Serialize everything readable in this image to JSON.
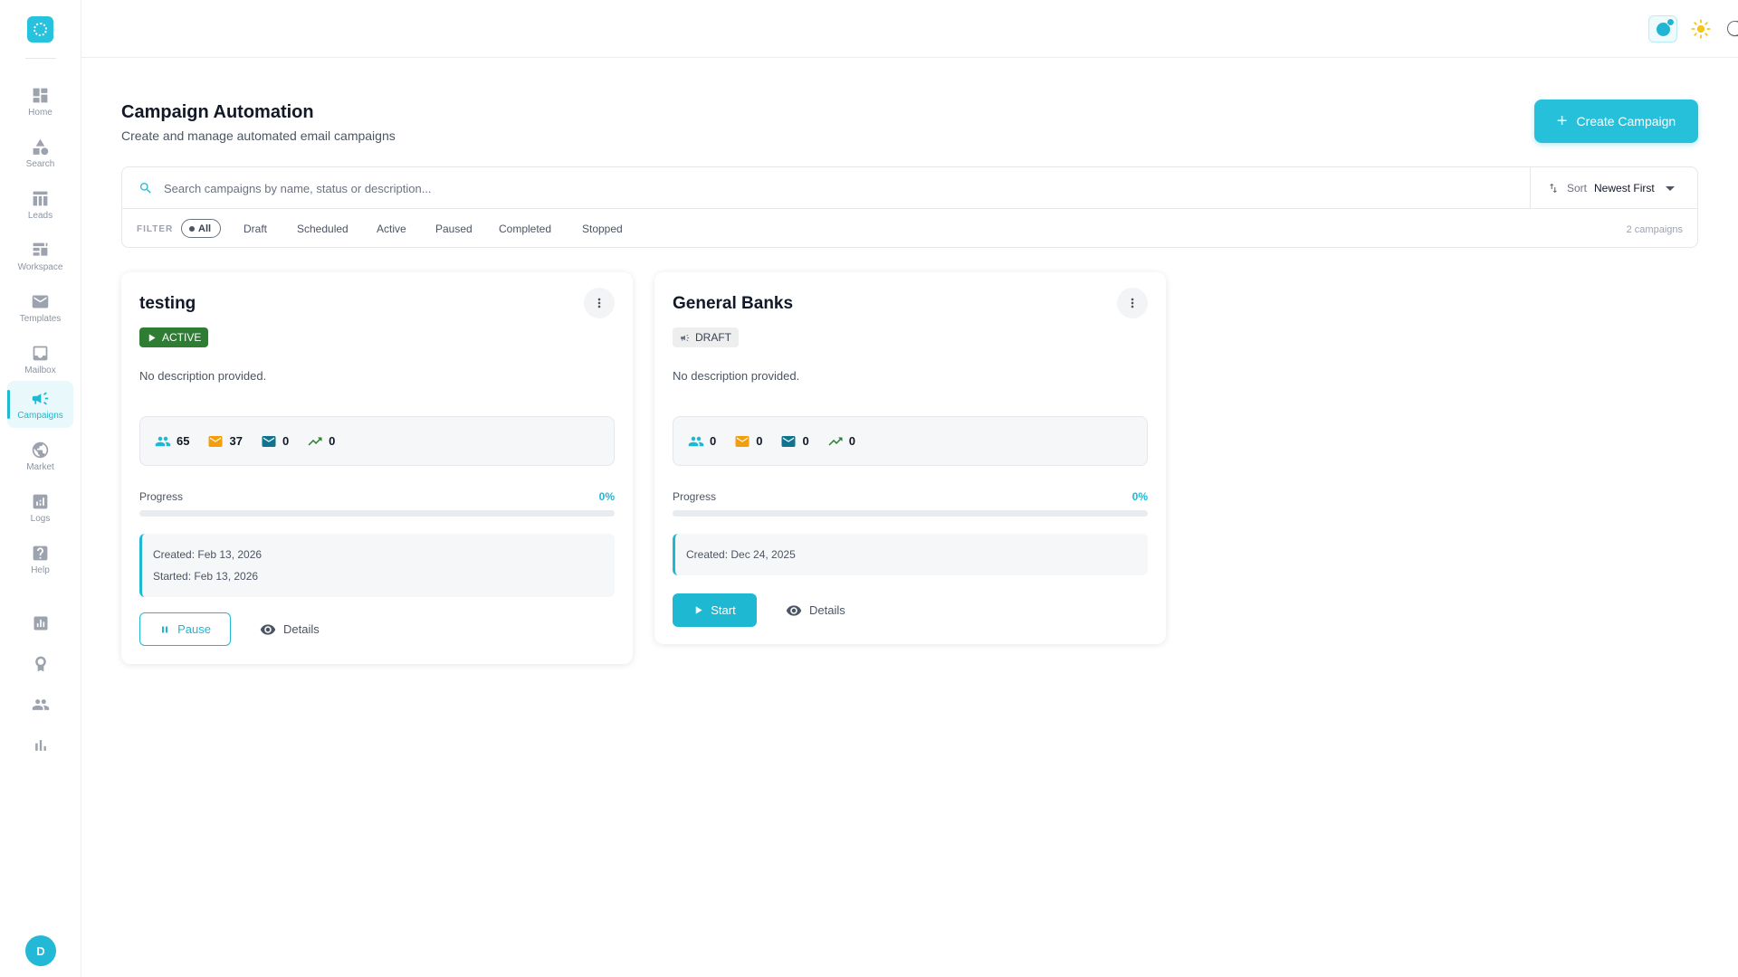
{
  "colors": {
    "accent": "#1fb8d3",
    "active_badge": "#2e7d32",
    "avatar": "#22b8d6"
  },
  "sidebar": {
    "items": [
      {
        "label": "Home",
        "icon": "dashboard-icon"
      },
      {
        "label": "Search",
        "icon": "shapes-icon"
      },
      {
        "label": "Leads",
        "icon": "table-icon"
      },
      {
        "label": "Workspace",
        "icon": "workspace-icon"
      },
      {
        "label": "Templates",
        "icon": "mail-icon"
      },
      {
        "label": "Mailbox",
        "icon": "inbox-icon"
      },
      {
        "label": "Campaigns",
        "icon": "megaphone-icon",
        "active": true
      },
      {
        "label": "Market",
        "icon": "globe-icon"
      },
      {
        "label": "Logs",
        "icon": "analytics-icon"
      },
      {
        "label": "Help",
        "icon": "help-icon"
      }
    ],
    "extra_icons": [
      "report-icon",
      "award-icon",
      "people-icon",
      "bar-chart-icon"
    ],
    "avatar_initial": "D"
  },
  "header": {
    "title": "Campaign Automation",
    "subtitle": "Create and manage automated email campaigns",
    "create_button": "Create Campaign"
  },
  "search": {
    "placeholder": "Search campaigns by name, status or description..."
  },
  "sort": {
    "label": "Sort",
    "value": "Newest First"
  },
  "filter": {
    "label": "FILTER",
    "options": [
      "All",
      "Draft",
      "Scheduled",
      "Active",
      "Paused",
      "Completed",
      "Stopped"
    ],
    "selected": "All",
    "count": "2 campaigns"
  },
  "campaigns": [
    {
      "name": "testing",
      "status": "ACTIVE",
      "description": "No description provided.",
      "stats": {
        "leads": "65",
        "sent": "37",
        "opened": "0",
        "replied": "0"
      },
      "progress_label": "Progress",
      "progress_pct": "0%",
      "progress_value": 0,
      "created": "Created: Feb 13, 2026",
      "started": "Started: Feb 13, 2026",
      "primary_action": "Pause",
      "details_action": "Details"
    },
    {
      "name": "General Banks",
      "status": "DRAFT",
      "description": "No description provided.",
      "stats": {
        "leads": "0",
        "sent": "0",
        "opened": "0",
        "replied": "0"
      },
      "progress_label": "Progress",
      "progress_pct": "0%",
      "progress_value": 0,
      "created": "Created: Dec 24, 2025",
      "primary_action": "Start",
      "details_action": "Details"
    }
  ]
}
